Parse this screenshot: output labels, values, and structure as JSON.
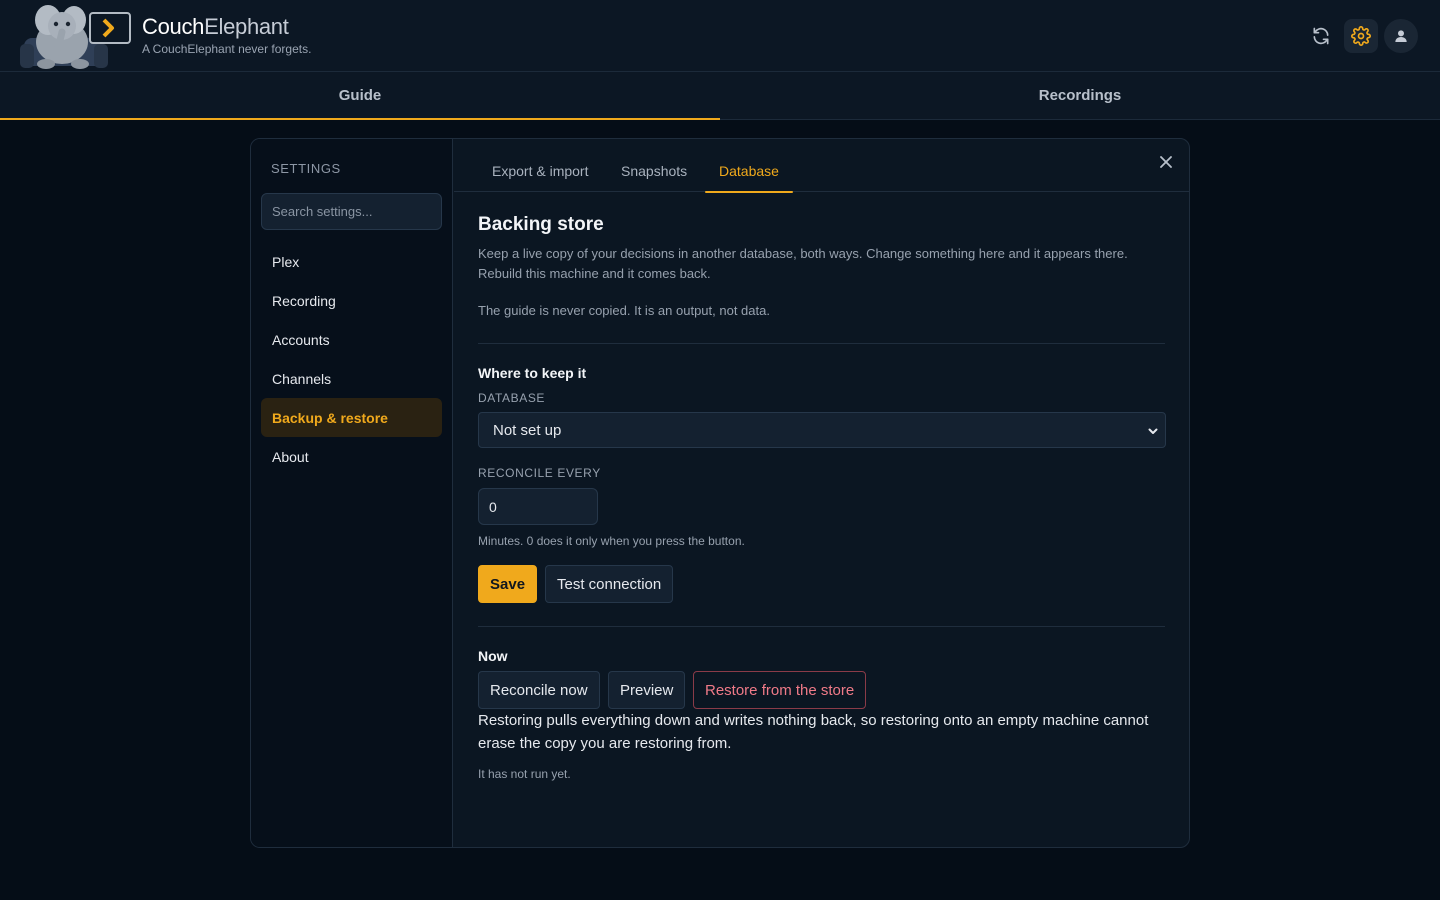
{
  "brand": {
    "name_part1": "Couch",
    "name_part2": "Elephant",
    "tagline": "A CouchElephant never forgets."
  },
  "header_icons": [
    "refresh-icon",
    "gear-icon",
    "user-icon"
  ],
  "nav": {
    "tabs": [
      {
        "label": "Guide",
        "active": true
      },
      {
        "label": "Recordings",
        "active": false
      }
    ]
  },
  "settings": {
    "title": "SETTINGS",
    "search_placeholder": "Search settings...",
    "items": [
      {
        "label": "Plex"
      },
      {
        "label": "Recording"
      },
      {
        "label": "Accounts"
      },
      {
        "label": "Channels"
      },
      {
        "label": "Backup & restore",
        "active": true
      },
      {
        "label": "About"
      }
    ]
  },
  "tabs": [
    {
      "label": "Export & import"
    },
    {
      "label": "Snapshots"
    },
    {
      "label": "Database",
      "active": true
    }
  ],
  "backing": {
    "title": "Backing store",
    "desc1": "Keep a live copy of your decisions in another database, both ways. Change something here and it appears there. Rebuild this machine and it comes back.",
    "desc2": "The guide is never copied. It is an output, not data.",
    "where_title": "Where to keep it",
    "database_label": "DATABASE",
    "database_value": "Not set up",
    "reconcile_label": "RECONCILE EVERY",
    "reconcile_value": "0",
    "reconcile_hint": "Minutes. 0 does it only when you press the button.",
    "save_label": "Save",
    "test_label": "Test connection",
    "now_title": "Now",
    "reconcile_now_label": "Reconcile now",
    "preview_label": "Preview",
    "restore_label": "Restore from the store",
    "restore_desc": "Restoring pulls everything down and writes nothing back, so restoring onto an empty machine cannot erase the copy you are restoring from.",
    "status": "It has not run yet."
  },
  "colors": {
    "accent": "#f0a91c",
    "danger": "#f07a88",
    "background": "#050d17",
    "panel": "#0b1622"
  }
}
